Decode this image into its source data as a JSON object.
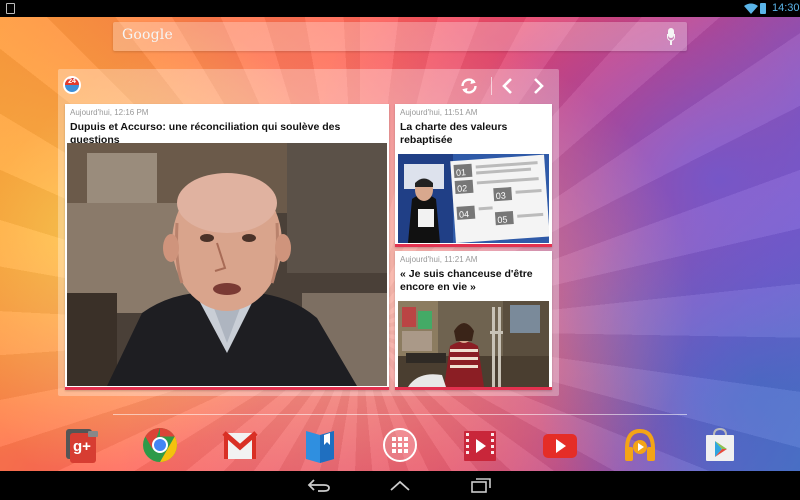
{
  "status_bar": {
    "time": "14:30",
    "icons": [
      "notification-icon",
      "wifi-icon",
      "battery-icon"
    ]
  },
  "search_bar": {
    "logo_text": "Google",
    "mic_icon": "mic-icon"
  },
  "news_widget": {
    "app_icon_text": "24",
    "controls": [
      "refresh-icon",
      "previous-icon",
      "next-icon"
    ],
    "articles": [
      {
        "time": "Aujourd'hui, 12:16 PM",
        "headline": "Dupuis et Accurso: une réconciliation qui soulève des questions"
      },
      {
        "time": "Aujourd'hui, 11:51 AM",
        "headline": "La charte des valeurs rebaptisée",
        "image_numbers": [
          "01",
          "02",
          "03",
          "04",
          "05"
        ]
      },
      {
        "time": "Aujourd'hui, 11:21 AM",
        "headline": "« Je suis chanceuse d'être encore en vie »"
      }
    ]
  },
  "dock": {
    "apps": [
      {
        "name": "Google+",
        "label": "g+",
        "icon": "google-plus-icon",
        "color": "#d73d32"
      },
      {
        "name": "Chrome",
        "icon": "chrome-icon",
        "color": "#2e9a48"
      },
      {
        "name": "Gmail",
        "label": "M",
        "icon": "gmail-icon",
        "color": "#d93025"
      },
      {
        "name": "Play Books",
        "icon": "play-books-icon",
        "color": "#2f8fe0"
      },
      {
        "name": "All apps",
        "icon": "app-drawer-icon",
        "color": "#ffffff"
      },
      {
        "name": "Play Movies",
        "icon": "play-movies-icon",
        "color": "#c9263a"
      },
      {
        "name": "YouTube",
        "icon": "youtube-icon",
        "color": "#e52d27"
      },
      {
        "name": "Play Music",
        "icon": "play-music-icon",
        "color": "#f4a416"
      },
      {
        "name": "Play Store",
        "icon": "play-store-icon",
        "color": "#8cc152"
      }
    ]
  },
  "nav_bar": {
    "buttons": [
      "back-icon",
      "home-icon",
      "recent-apps-icon"
    ]
  }
}
